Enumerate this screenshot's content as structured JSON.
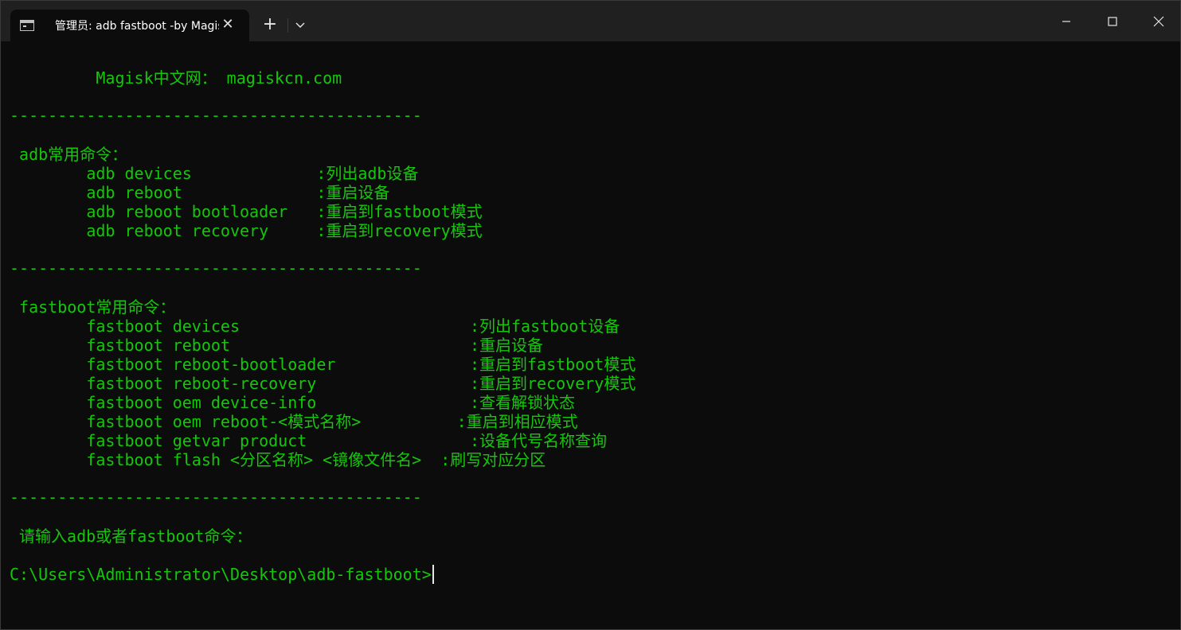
{
  "window": {
    "tab_title": "管理员:  adb fastboot -by Magisk中文网",
    "tab_icon": "terminal-icon",
    "new_tab_symbol": "+",
    "close_tab_symbol": "✕"
  },
  "terminal": {
    "text_color": "#16c60c",
    "lines": [
      "         Magisk中文网： magiskcn.com",
      "-------------------------------------------",
      " adb常用命令：",
      "        adb devices             :列出adb设备",
      "        adb reboot              :重启设备",
      "        adb reboot bootloader   :重启到fastboot模式",
      "        adb reboot recovery     :重启到recovery模式",
      "-------------------------------------------",
      " fastboot常用命令：",
      "        fastboot devices                        :列出fastboot设备",
      "        fastboot reboot                         :重启设备",
      "        fastboot reboot-bootloader              :重启到fastboot模式",
      "        fastboot reboot-recovery                :重启到recovery模式",
      "        fastboot oem device-info                :查看解锁状态",
      "        fastboot oem reboot-<模式名称>          :重启到相应模式",
      "        fastboot getvar product                 :设备代号名称查询",
      "        fastboot flash <分区名称> <镜像文件名>  :刷写对应分区",
      "-------------------------------------------",
      " 请输入adb或者fastboot命令：",
      "C:\\Users\\Administrator\\Desktop\\adb-fastboot>"
    ]
  }
}
